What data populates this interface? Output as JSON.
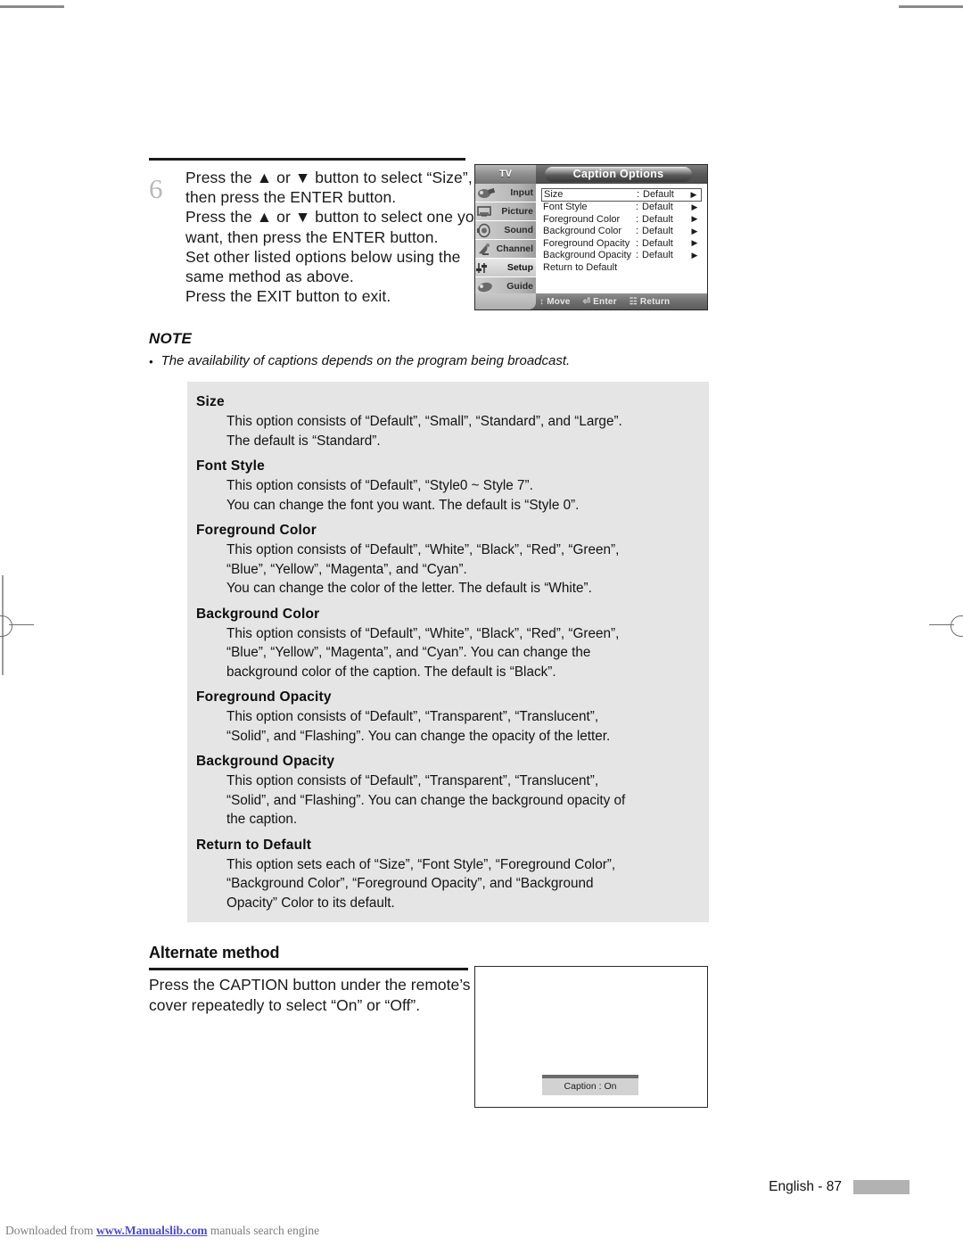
{
  "page": {
    "footer_text": "English - 87",
    "download_prefix": "Downloaded from",
    "download_link": "www.Manualslib.com",
    "download_suffix": "manuals search engine"
  },
  "step": {
    "number": "6",
    "lines": [
      "Press the ▲ or ▼ button to select “Size”,",
      "then press the ENTER button.",
      "Press the ▲ or ▼ button to select one you",
      "want, then press the ENTER button.",
      "Set other listed options below using the",
      "same method as above.",
      "Press the EXIT button to exit."
    ]
  },
  "osd": {
    "brand_label": "TV",
    "title": "Caption Options",
    "sidebar": [
      {
        "label": "Input",
        "icon": "input-source-icon",
        "selected": false
      },
      {
        "label": "Picture",
        "icon": "picture-monitor-icon",
        "selected": false
      },
      {
        "label": "Sound",
        "icon": "speaker-icon",
        "selected": false
      },
      {
        "label": "Channel",
        "icon": "satellite-dish-icon",
        "selected": false
      },
      {
        "label": "Setup",
        "icon": "sliders-icon",
        "selected": true
      },
      {
        "label": "Guide",
        "icon": "guide-icon",
        "selected": false
      }
    ],
    "rows": [
      {
        "label": "Size",
        "colon": ":",
        "value": "Default",
        "arrow": "▶",
        "highlighted": true
      },
      {
        "label": "Font Style",
        "colon": ":",
        "value": "Default",
        "arrow": "▶",
        "highlighted": false
      },
      {
        "label": "Foreground Color",
        "colon": ":",
        "value": "Default",
        "arrow": "▶",
        "highlighted": false
      },
      {
        "label": "Background Color",
        "colon": ":",
        "value": "Default",
        "arrow": "▶",
        "highlighted": false
      },
      {
        "label": "Foreground Opacity",
        "colon": ":",
        "value": "Default",
        "arrow": "▶",
        "highlighted": false
      },
      {
        "label": "Background Opacity",
        "colon": ":",
        "value": "Default",
        "arrow": "▶",
        "highlighted": false
      },
      {
        "label": "Return to Default",
        "colon": "",
        "value": "",
        "arrow": "",
        "highlighted": false
      }
    ],
    "footer": [
      {
        "glyph": "↕",
        "label": "Move",
        "icon": "updown-arrow-icon"
      },
      {
        "glyph": "⏎",
        "label": "Enter",
        "icon": "enter-button-icon"
      },
      {
        "glyph": "☷",
        "label": "Return",
        "icon": "return-button-icon"
      }
    ]
  },
  "note": {
    "title": "NOTE",
    "bullet": "The availability of captions depends on the program being broadcast."
  },
  "options": [
    {
      "name": "Size",
      "lines": [
        "This option consists of “Default”, “Small”, “Standard”, and “Large”.",
        "The default is “Standard”."
      ]
    },
    {
      "name": "Font Style",
      "lines": [
        "This option consists of “Default”, “Style0 ~ Style 7”.",
        "You can change the font you want. The default is “Style 0”."
      ]
    },
    {
      "name": "Foreground Color",
      "lines": [
        "This option consists of “Default”, “White”, “Black”, “Red”, “Green”,",
        "“Blue”, “Yellow”, “Magenta”, and “Cyan”.",
        "You can change the color of the letter. The default is “White”."
      ]
    },
    {
      "name": "Background Color",
      "lines": [
        "This option consists of “Default”, “White”, “Black”, “Red”, “Green”,",
        "“Blue”, “Yellow”, “Magenta”, and “Cyan”. You can change the",
        "background color of the caption. The default is “Black”."
      ]
    },
    {
      "name": "Foreground Opacity",
      "lines": [
        "This option consists of “Default”, “Transparent”, “Translucent”,",
        "“Solid”, and “Flashing”. You can change the opacity of the letter."
      ]
    },
    {
      "name": "Background Opacity",
      "lines": [
        "This option consists of “Default”, “Transparent”, “Translucent”,",
        "“Solid”, and “Flashing”. You can change the background opacity of",
        "the caption."
      ]
    },
    {
      "name": "Return to Default",
      "lines": [
        "This option sets each of “Size”, “Font Style”, “Foreground Color”,",
        "“Background Color”, “Foreground Opacity”, and “Background",
        "Opacity” Color to its default."
      ]
    }
  ],
  "alternate": {
    "title": "Alternate method",
    "lines": [
      "Press the CAPTION button under the remote’s",
      "cover repeatedly to select “On” or “Off”."
    ],
    "caption_osd": "Caption : On"
  }
}
